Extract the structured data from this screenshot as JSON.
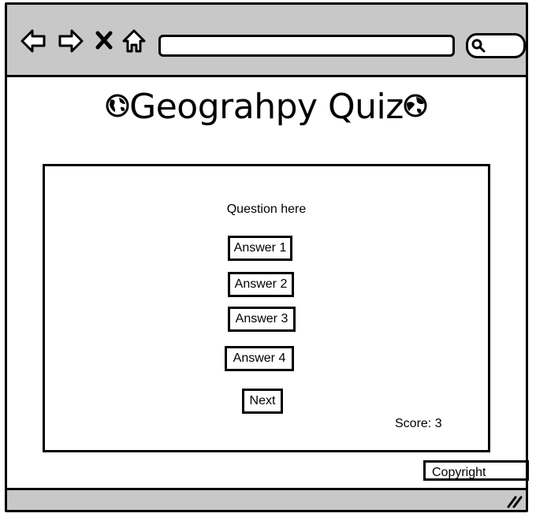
{
  "browser": {
    "url": "",
    "search_value": ""
  },
  "page": {
    "title": "Geograhpy Quiz"
  },
  "quiz": {
    "question": "Question here",
    "answers": [
      "Answer 1",
      "Answer 2",
      "Answer 3",
      "Answer 4"
    ],
    "next_label": "Next",
    "score_text": "Score: 3"
  },
  "footer": {
    "copyright": "Copyright"
  },
  "icons": {
    "back": "back-arrow-icon",
    "forward": "forward-arrow-icon",
    "stop": "close-icon",
    "home": "home-icon",
    "search": "search-icon",
    "globe": "globe-icon",
    "resize": "resize-grip-icon"
  },
  "colors": {
    "chrome": "#c8c8c8",
    "stroke": "#000000",
    "background": "#ffffff"
  }
}
